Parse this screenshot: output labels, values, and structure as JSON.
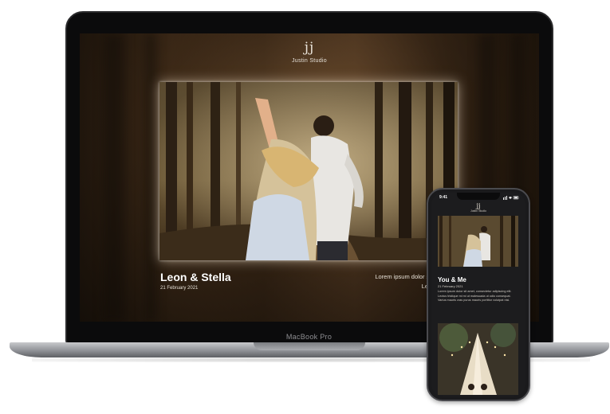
{
  "laptop": {
    "model_label": "MacBook Pro",
    "site": {
      "logo_mark": "jj",
      "name": "Justin Studio",
      "hero": {
        "photo": "couple-dancing-in-forest-photo",
        "title": "Leon & Stella",
        "date": "21 February 2021",
        "description_line1": "Lorem ipsum dolor sit amet, consectetur adip",
        "description_line2": "Lectus tristique mi mi ut ma"
      }
    }
  },
  "phone": {
    "time": "9:41",
    "status_icons": "signal wifi battery",
    "site": {
      "logo_mark": "jj",
      "name": "Justin Studio",
      "photo1": "couple-dancing-in-forest-photo",
      "heading": "You & Me",
      "date": "21 February 2021",
      "body": "Lorem ipsum dolor sit amet, consectetur adipiscing elit. Lectus tristique mi mi ut malesuada ut odio consequat. Varius mauris cras purus mauris porttitor volutpat nisi.",
      "photo2": "tipi-tent-with-fairy-lights-photo"
    }
  },
  "colors": {
    "screen_bg": "#2a1c10",
    "text_light": "#e8e2d8",
    "device_dark": "#0b0b0c",
    "device_base": "#8f9196"
  }
}
